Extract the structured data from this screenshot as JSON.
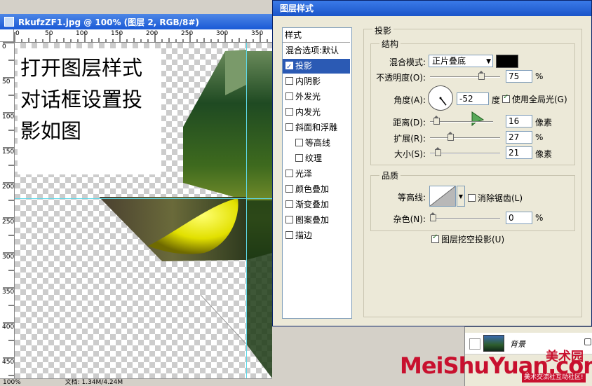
{
  "document": {
    "title": "RkufzZF1.jpg @ 100% (图层 2, RGB/8#)",
    "top_ruler_labels": [
      "0",
      "50",
      "100",
      "150",
      "200",
      "250",
      "300",
      "350"
    ],
    "left_ruler_labels": [
      "0",
      "50",
      "100",
      "150",
      "200",
      "250",
      "300",
      "350",
      "400",
      "450"
    ],
    "note_lines": [
      "打开图层样式",
      "对话框设置投",
      "影如图"
    ],
    "status_left": "100%",
    "status_doc": "文档: 1.34M/4.24M"
  },
  "dialog": {
    "title": "图层样式",
    "styles_header": "样式",
    "style_items": [
      {
        "label": "混合选项:默认",
        "checkbox": false,
        "checked": false,
        "indent": false,
        "selected": false
      },
      {
        "label": "投影",
        "checkbox": true,
        "checked": true,
        "indent": false,
        "selected": true
      },
      {
        "label": "内阴影",
        "checkbox": true,
        "checked": false,
        "indent": false,
        "selected": false
      },
      {
        "label": "外发光",
        "checkbox": true,
        "checked": false,
        "indent": false,
        "selected": false
      },
      {
        "label": "内发光",
        "checkbox": true,
        "checked": false,
        "indent": false,
        "selected": false
      },
      {
        "label": "斜面和浮雕",
        "checkbox": true,
        "checked": false,
        "indent": false,
        "selected": false
      },
      {
        "label": "等高线",
        "checkbox": true,
        "checked": false,
        "indent": true,
        "selected": false
      },
      {
        "label": "纹理",
        "checkbox": true,
        "checked": false,
        "indent": true,
        "selected": false
      },
      {
        "label": "光泽",
        "checkbox": true,
        "checked": false,
        "indent": false,
        "selected": false
      },
      {
        "label": "颜色叠加",
        "checkbox": true,
        "checked": false,
        "indent": false,
        "selected": false
      },
      {
        "label": "渐变叠加",
        "checkbox": true,
        "checked": false,
        "indent": false,
        "selected": false
      },
      {
        "label": "图案叠加",
        "checkbox": true,
        "checked": false,
        "indent": false,
        "selected": false
      },
      {
        "label": "描边",
        "checkbox": true,
        "checked": false,
        "indent": false,
        "selected": false
      }
    ],
    "drop_shadow": {
      "group_title": "投影",
      "structure_title": "结构",
      "blend_mode_label": "混合模式:",
      "blend_mode_value": "正片叠底",
      "shadow_color": "#000000",
      "opacity_label": "不透明度(O):",
      "opacity_value": "75",
      "opacity_unit": "%",
      "opacity_fraction": 0.75,
      "angle_label": "角度(A):",
      "angle_value": "-52",
      "angle_unit": "度",
      "angle_degrees": -52,
      "global_light_label": "使用全局光(G)",
      "global_light_checked": true,
      "distance_label": "距离(D):",
      "distance_value": "16",
      "distance_unit": "像素",
      "distance_fraction": 0.06,
      "spread_label": "扩展(R):",
      "spread_value": "27",
      "spread_unit": "%",
      "spread_fraction": 0.27,
      "size_label": "大小(S):",
      "size_value": "21",
      "size_unit": "像素",
      "size_fraction": 0.08
    },
    "quality": {
      "title": "品质",
      "contour_label": "等高线:",
      "anti_alias_label": "消除锯齿(L)",
      "anti_alias_checked": false,
      "noise_label": "杂色(N):",
      "noise_value": "0",
      "noise_unit": "%",
      "noise_fraction": 0.0
    },
    "knockout_label": "图层挖空投影(U)",
    "knockout_checked": true
  },
  "layers": {
    "background_name": "背景"
  },
  "watermark": {
    "text": "MeiShuYuan.com",
    "cn": "美术园",
    "tag": "美术交流社互动社区!"
  },
  "colors": {
    "selection_blue": "#2b5ab4",
    "title_blue": "#1b55c9",
    "guide_cyan": "#5ed8e8",
    "watermark_red": "#c8102e"
  }
}
